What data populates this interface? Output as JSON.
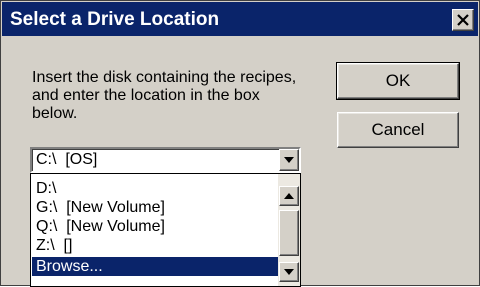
{
  "window": {
    "title": "Select a Drive Location",
    "close_label": "×"
  },
  "message": "Insert the disk containing the recipes, and enter the location in the box below.",
  "buttons": {
    "ok_label": "OK",
    "cancel_label": "Cancel"
  },
  "drive_combo": {
    "selected_value": "C:\\  [OS]",
    "arrow_icon": "chevron-down-icon"
  },
  "drive_list": {
    "items": [
      {
        "label": "D:\\"
      },
      {
        "label": "G:\\  [New Volume]"
      },
      {
        "label": "Q:\\  [New Volume]"
      },
      {
        "label": "Z:\\  []"
      },
      {
        "label": "Browse..."
      }
    ],
    "highlighted_index": 4
  },
  "colors": {
    "titlebar": "#0a246a",
    "face": "#d4d0c8",
    "selection": "#0a246a"
  }
}
